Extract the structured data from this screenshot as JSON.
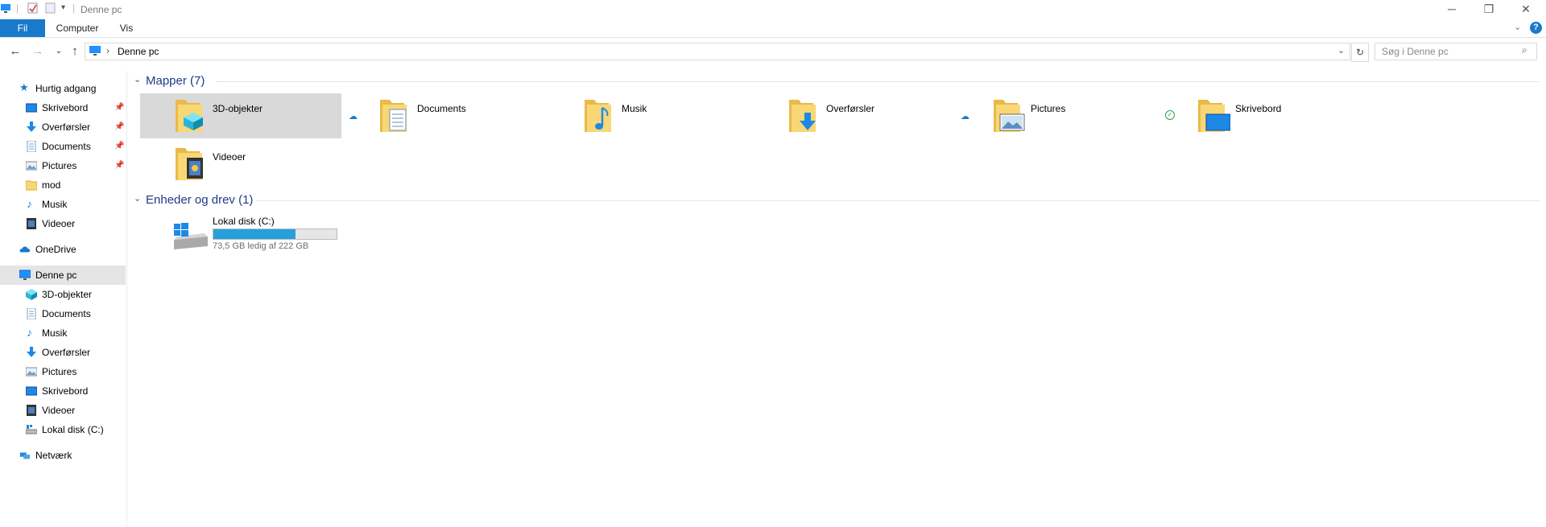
{
  "window": {
    "title": "Denne pc",
    "controls": {
      "minimize": "─",
      "restore": "❐",
      "close": "✕"
    }
  },
  "ribbon": {
    "tabs": [
      {
        "label": "Fil",
        "active": true
      },
      {
        "label": "Computer"
      },
      {
        "label": "Vis"
      }
    ],
    "help": "?"
  },
  "address": {
    "path": "Denne pc",
    "search_placeholder": "Søg i Denne pc"
  },
  "nav": {
    "quick_access": "Hurtig adgang",
    "quick_items": [
      {
        "label": "Skrivebord",
        "pinned": true
      },
      {
        "label": "Overførsler",
        "pinned": true
      },
      {
        "label": "Documents",
        "pinned": true
      },
      {
        "label": "Pictures",
        "pinned": true
      },
      {
        "label": "mod",
        "pinned": false
      },
      {
        "label": "Musik",
        "pinned": false
      },
      {
        "label": "Videoer",
        "pinned": false
      }
    ],
    "onedrive": "OneDrive",
    "this_pc": "Denne pc",
    "pc_items": [
      {
        "label": "3D-objekter"
      },
      {
        "label": "Documents"
      },
      {
        "label": "Musik"
      },
      {
        "label": "Overførsler"
      },
      {
        "label": "Pictures"
      },
      {
        "label": "Skrivebord"
      },
      {
        "label": "Videoer"
      },
      {
        "label": "Lokal disk (C:)"
      }
    ],
    "network": "Netværk"
  },
  "content": {
    "folders_header": "Mapper (7)",
    "folders": [
      {
        "label": "3D-objekter",
        "icon": "3d-objects-folder-icon",
        "status": "cloud"
      },
      {
        "label": "Documents",
        "icon": "documents-folder-icon",
        "status": ""
      },
      {
        "label": "Musik",
        "icon": "music-folder-icon",
        "status": ""
      },
      {
        "label": "Overførsler",
        "icon": "downloads-folder-icon",
        "status": "cloud"
      },
      {
        "label": "Pictures",
        "icon": "pictures-folder-icon",
        "status": "check"
      },
      {
        "label": "Skrivebord",
        "icon": "desktop-folder-icon",
        "status": ""
      },
      {
        "label": "Videoer",
        "icon": "videos-folder-icon",
        "status": ""
      }
    ],
    "drives_header": "Enheder og drev (1)",
    "drives": [
      {
        "label": "Lokal disk (C:)",
        "free_text": "73,5 GB ledig af 222 GB",
        "used_fraction": 0.669
      }
    ]
  },
  "colors": {
    "accent": "#1979ca",
    "folder": "#f8d775",
    "group_header": "#1e3a8a",
    "drive_bar": "#26a0da"
  }
}
